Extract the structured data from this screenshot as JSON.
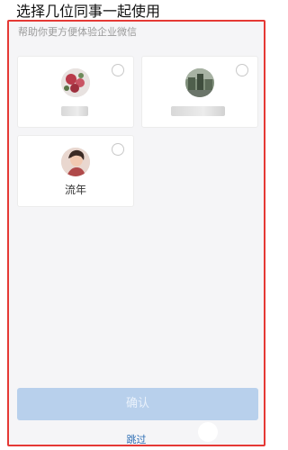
{
  "header": {
    "title": "选择几位同事一起使用"
  },
  "panel": {
    "subtitle": "帮助你更方便体验企业微信"
  },
  "colleagues": [
    {
      "name": "",
      "avatar_icon": "flower-photo-avatar",
      "selected": false
    },
    {
      "name": "",
      "avatar_icon": "landscape-photo-avatar",
      "selected": false
    },
    {
      "name": "流年",
      "avatar_icon": "person-photo-avatar",
      "selected": false
    }
  ],
  "actions": {
    "confirm_label": "确认",
    "skip_label": "跳过"
  },
  "colors": {
    "highlight_border": "#e53935",
    "confirm_disabled": "#b8d0ec",
    "link": "#2f6fb5"
  }
}
